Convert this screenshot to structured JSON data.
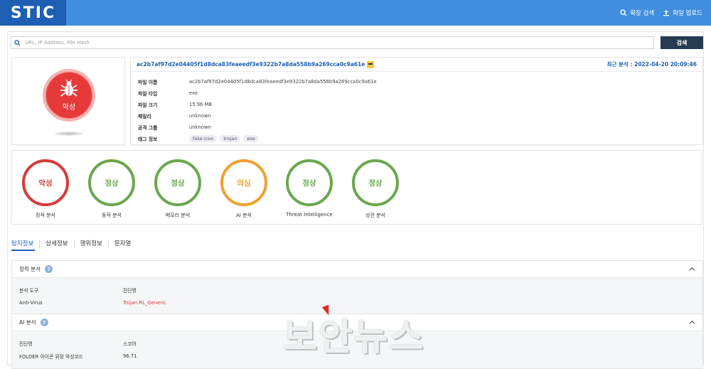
{
  "header": {
    "logo": "STIC",
    "links": [
      {
        "label": "확장 검색",
        "icon": "search-icon"
      },
      {
        "label": "파일 업로드",
        "icon": "upload-icon"
      }
    ]
  },
  "search": {
    "placeholder": "URL, IP Address, File Hash",
    "button_label": "검색"
  },
  "verdict": {
    "label": "악성",
    "icon": "bug-icon",
    "color": "#e63a3a"
  },
  "file_info": {
    "hash": "ac2b7af97d2e04405f1d8dca83feaeedf3e9322b7a8da558b9a269cca0c9a61e",
    "last_analysis": "최근 분석 : 2022-04-20 20:09:46",
    "rows": [
      {
        "key": "파일 이름",
        "value": "ac2b7af97d2e04405f1d8dca83feaeedf3e9322b7a8da558b9a269cca0c9a61e"
      },
      {
        "key": "파일 타입",
        "value": "exe"
      },
      {
        "key": "파일 크기",
        "value": "15.96 MB"
      },
      {
        "key": "패밀리",
        "value": "unknown"
      },
      {
        "key": "공격 그룹",
        "value": "unknown"
      }
    ],
    "tag_key": "태그 정보",
    "tags": [
      "fake icon",
      "trojan",
      "exe"
    ]
  },
  "analyses": [
    {
      "result": "악성",
      "label": "정적 분석",
      "color": "red"
    },
    {
      "result": "정상",
      "label": "동적 분석",
      "color": "green"
    },
    {
      "result": "정상",
      "label": "메모리 분석",
      "color": "green"
    },
    {
      "result": "의심",
      "label": "AI 분석",
      "color": "orange"
    },
    {
      "result": "정상",
      "label": "Threat Intelligence",
      "color": "green"
    },
    {
      "result": "정상",
      "label": "상관 분석",
      "color": "green"
    }
  ],
  "tabs": [
    "탐지정보",
    "상세정보",
    "행위정보",
    "문자열"
  ],
  "sections": {
    "static": {
      "title": "정적 분석",
      "headers": [
        "분석 도구",
        "진단명"
      ],
      "rows": [
        [
          "Anti-Virus",
          "Trojan.RL_Generic"
        ]
      ]
    },
    "ai": {
      "title": "AI 분석",
      "headers": [
        "진단명",
        "스코어"
      ],
      "rows": [
        [
          "FOLDER 아이콘 위장 악성코드",
          "96.71"
        ]
      ]
    }
  },
  "watermark": "보안뉴스"
}
